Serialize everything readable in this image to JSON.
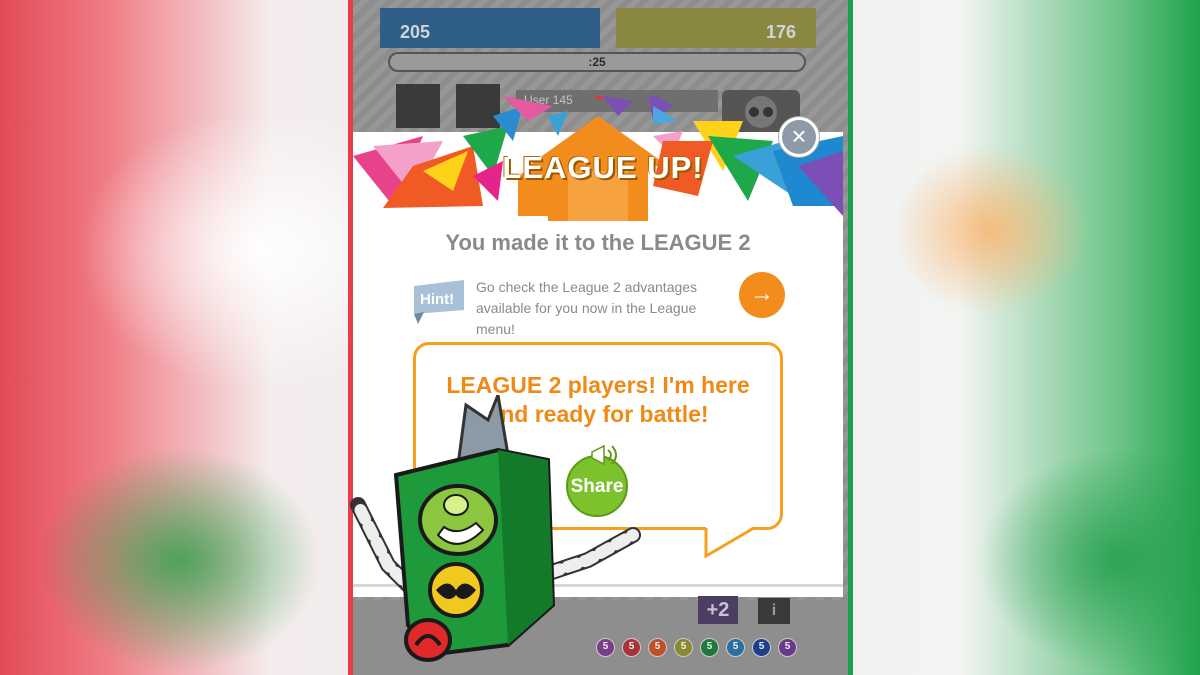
{
  "scores": {
    "left": "205",
    "right": "176"
  },
  "timer": ":25",
  "user_label": "User 145",
  "popup": {
    "title": "LEAGUE UP!",
    "subtitle": "You made it to the LEAGUE 2",
    "hint_tag": "Hint!",
    "hint_text": "Go check the League 2 advantages available for you now in the League menu!",
    "hint_arrow": "→",
    "close": "×",
    "bubble_text": "LEAGUE 2 players! I'm here and ready for battle!",
    "share_label": "Share"
  },
  "bottom": {
    "plus_label": "+2",
    "info_label": "i",
    "coins": [
      {
        "label": "5",
        "color": "#7a3d8a"
      },
      {
        "label": "5",
        "color": "#a8323a"
      },
      {
        "label": "5",
        "color": "#c0502a"
      },
      {
        "label": "5",
        "color": "#8a8a30"
      },
      {
        "label": "5",
        "color": "#1e7a3a"
      },
      {
        "label": "5",
        "color": "#2a6fa0"
      },
      {
        "label": "5",
        "color": "#1e3f8a"
      },
      {
        "label": "5",
        "color": "#6a3a8a"
      }
    ]
  },
  "colors": {
    "accent_orange": "#f28c1d",
    "frame_red": "#e83c4a",
    "frame_green": "#1aa04a",
    "share_green": "#7cc22c"
  }
}
